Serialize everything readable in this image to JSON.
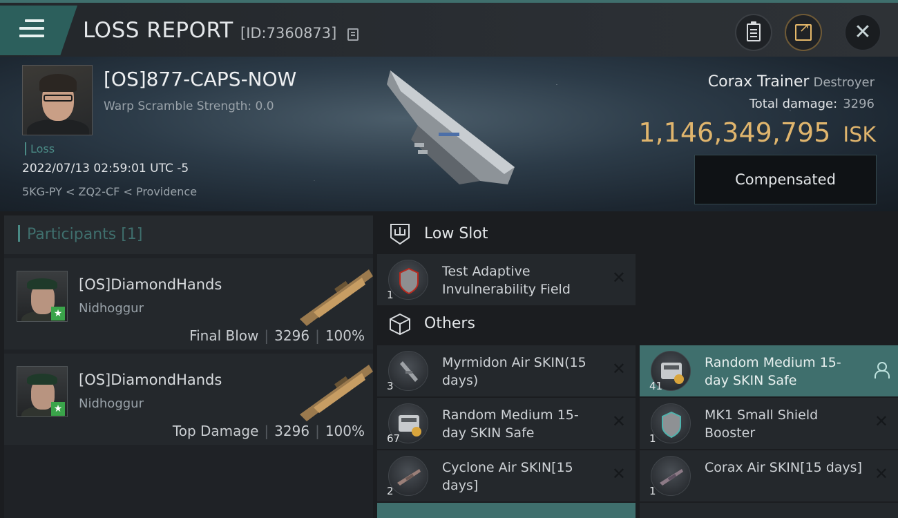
{
  "header": {
    "title": "LOSS REPORT",
    "report_id": "[ID:7360873]"
  },
  "victim": {
    "name": "[OS]877-CAPS-NOW",
    "warp_scramble": "Warp Scramble Strength: 0.0",
    "loss_label": "Loss",
    "datetime": "2022/07/13 02:59:01 UTC -5",
    "location": "5KG-PY < ZQ2-CF < Providence",
    "ship_name": "Corax Trainer",
    "ship_class": "Destroyer",
    "total_damage_label": "Total damage:",
    "total_damage": "3296",
    "isk_value": "1,146,349,795",
    "isk_unit": "ISK",
    "compensated_label": "Compensated"
  },
  "participants": {
    "title": "Participants",
    "count": "[1]",
    "list": [
      {
        "name": "[OS]DiamondHands",
        "ship": "Nidhoggur",
        "role": "Final Blow",
        "damage": "3296",
        "percent": "100%"
      },
      {
        "name": "[OS]DiamondHands",
        "ship": "Nidhoggur",
        "role": "Top Damage",
        "damage": "3296",
        "percent": "100%"
      }
    ]
  },
  "sections": {
    "low_slot": "Low Slot",
    "others": "Others"
  },
  "items": {
    "low_slot": [
      {
        "qty": "1",
        "name": "Test Adaptive Invulnerability Field",
        "icon": "shield-hardener-icon"
      }
    ],
    "others": [
      {
        "qty": "3",
        "name": "Myrmidon Air SKIN(15 days)",
        "icon": "ship-skin-icon"
      },
      {
        "qty": "41",
        "name": "Random Medium 15-day SKIN Safe",
        "icon": "skin-safe-icon",
        "selected": true
      },
      {
        "qty": "67",
        "name": "Random Medium 15-day SKIN Safe",
        "icon": "skin-safe-icon"
      },
      {
        "qty": "1",
        "name": "MK1 Small Shield Booster",
        "icon": "shield-booster-icon"
      },
      {
        "qty": "2",
        "name": "Cyclone Air SKIN[15 days]",
        "icon": "ship-skin-icon"
      },
      {
        "qty": "1",
        "name": "Corax Air SKIN[15 days]",
        "icon": "ship-skin-icon"
      }
    ]
  },
  "colors": {
    "accent": "#3f6f6d",
    "isk": "#e0b56d",
    "background": "#1b1d20"
  }
}
